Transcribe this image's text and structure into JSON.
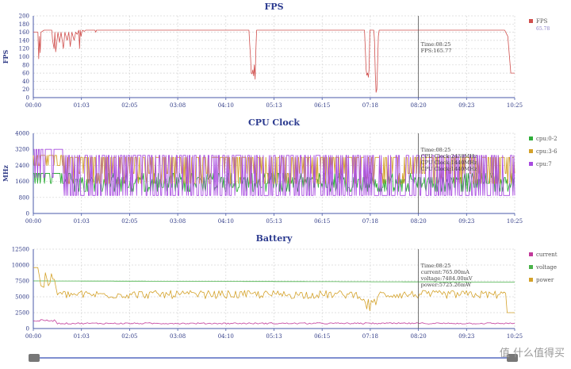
{
  "chart_data": [
    {
      "id": "fps",
      "type": "line",
      "title": "FPS",
      "ylabel": "FPS",
      "ylim": [
        0,
        200
      ],
      "yticks": [
        0,
        20,
        40,
        60,
        80,
        100,
        120,
        140,
        160,
        180,
        200
      ],
      "xlim": [
        0,
        625
      ],
      "xticks": [
        "00:00",
        "01:03",
        "02:05",
        "03:08",
        "04:10",
        "05:13",
        "06:15",
        "07:18",
        "08:20",
        "09:23",
        "10:25"
      ],
      "grid": true,
      "legend_position": "right",
      "series": [
        {
          "name": "FPS",
          "legend_sub": "65.78",
          "color": "#d0504e",
          "x": [
            0,
            6,
            7,
            8,
            9,
            10,
            14,
            24,
            25,
            27,
            28,
            29,
            32,
            34,
            36,
            39,
            41,
            44,
            46,
            48,
            50,
            53,
            55,
            57,
            59,
            60,
            61,
            62,
            63,
            64,
            66,
            68,
            72,
            80,
            81,
            82,
            90,
            100,
            200,
            280,
            281,
            282,
            283,
            284,
            285,
            286,
            287,
            288,
            289,
            290,
            292,
            300,
            360,
            430,
            431,
            432,
            433,
            434,
            435,
            436,
            437,
            442,
            443,
            444,
            445,
            446,
            447,
            448,
            449,
            450,
            455,
            560,
            590,
            595,
            600,
            601,
            602,
            603,
            606,
            610,
            612,
            616,
            620,
            625
          ],
          "y": [
            160,
            160,
            95,
            150,
            110,
            160,
            165,
            165,
            140,
            120,
            160,
            112,
            160,
            135,
            160,
            120,
            160,
            140,
            160,
            125,
            160,
            140,
            160,
            155,
            165,
            120,
            165,
            150,
            160,
            165,
            162,
            165,
            165,
            165,
            160,
            165,
            165,
            165,
            165,
            165,
            130,
            100,
            60,
            58,
            68,
            53,
            80,
            45,
            120,
            165,
            165,
            165,
            165,
            165,
            120,
            70,
            55,
            60,
            50,
            70,
            165,
            165,
            140,
            60,
            13,
            20,
            80,
            150,
            165,
            165,
            165,
            165,
            165,
            165,
            165,
            165,
            165,
            165,
            165,
            165,
            165,
            150,
            60,
            60
          ]
        }
      ],
      "cursor": {
        "x": 500,
        "tooltip": [
          "Time:08:25",
          "FPS:165.77"
        ]
      }
    },
    {
      "id": "cpu",
      "type": "line",
      "title": "CPU Clock",
      "ylabel": "MHz",
      "ylim": [
        0,
        4000
      ],
      "yticks": [
        0,
        800,
        1600,
        2400,
        3200,
        4000
      ],
      "xlim": [
        0,
        625
      ],
      "xticks": [
        "00:00",
        "01:03",
        "02:05",
        "03:08",
        "04:10",
        "05:13",
        "06:15",
        "07:18",
        "08:20",
        "09:23",
        "10:25"
      ],
      "grid": true,
      "legend_position": "right",
      "series": [
        {
          "name": "cpu:0-2",
          "color": "#2fae3a"
        },
        {
          "name": "cpu:3-6",
          "color": "#d4a22a"
        },
        {
          "name": "cpu:7",
          "color": "#a84be0"
        }
      ],
      "cursor": {
        "x": 500,
        "tooltip": [
          "Time:08:25",
          "CPU Clock:2438MHz",
          "CPU Clock:1440MHz",
          "CPU Clock:1440MHz"
        ]
      }
    },
    {
      "id": "battery",
      "type": "line",
      "title": "Battery",
      "ylim": [
        0,
        12500
      ],
      "yticks": [
        0,
        2500,
        5000,
        7500,
        10000,
        12500
      ],
      "xlim": [
        0,
        625
      ],
      "xticks": [
        "00:00",
        "01:03",
        "02:05",
        "03:08",
        "04:10",
        "05:13",
        "06:15",
        "07:18",
        "08:20",
        "09:23",
        "10:25"
      ],
      "grid": true,
      "legend_position": "right",
      "series": [
        {
          "name": "current",
          "color": "#c23a9a"
        },
        {
          "name": "voltage",
          "color": "#4ab34a"
        },
        {
          "name": "power",
          "color": "#d4a22a"
        }
      ],
      "cursor": {
        "x": 500,
        "tooltip": [
          "Time:08:25",
          "current:765.00mA",
          "voltage:7484.00mV",
          "power:5725.26mW"
        ]
      }
    }
  ],
  "watermark": "值 什么值得买"
}
